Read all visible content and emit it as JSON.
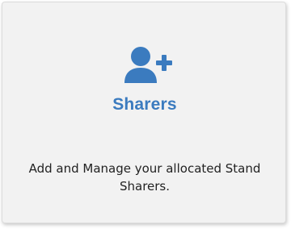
{
  "card": {
    "icon": "user-plus-icon",
    "title": "Sharers",
    "description": "Add and Manage your allocated Stand Sharers.",
    "accent_color": "#3b7bbf"
  }
}
